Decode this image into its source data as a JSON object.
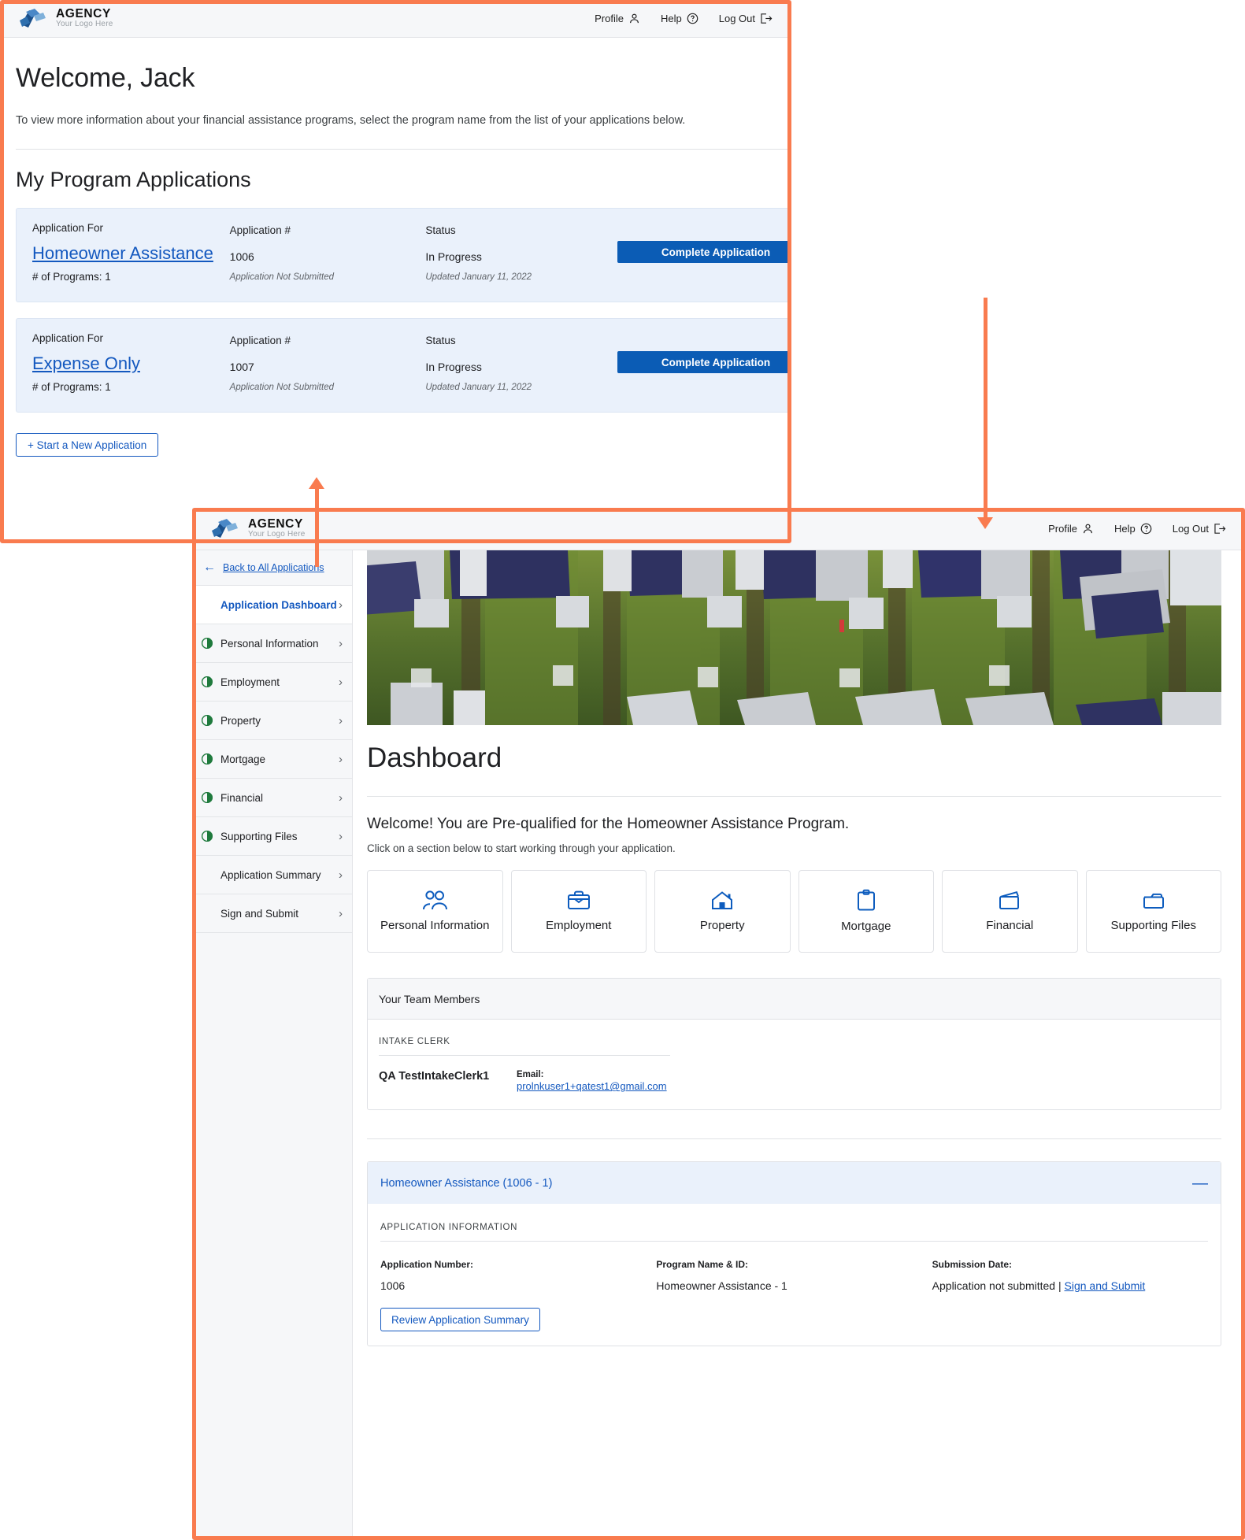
{
  "brand": {
    "name": "AGENCY",
    "tagline": "Your Logo Here"
  },
  "topnav": {
    "profile": "Profile",
    "help": "Help",
    "logout": "Log Out"
  },
  "outer": {
    "heading": "Welcome, Jack",
    "intro": "To view more information about your financial assistance programs, select the program name from the list of your applications below.",
    "section_title": "My Program Applications",
    "columns": {
      "application_for": "Application For",
      "application_number": "Application #",
      "status": "Status"
    },
    "applications": [
      {
        "program": "Homeowner Assistance",
        "programs_count": "# of Programs: 1",
        "number": "1006",
        "number_note": "Application Not Submitted",
        "status": "In Progress",
        "status_note": "Updated January 11, 2022",
        "action": "Complete Application"
      },
      {
        "program": "Expense Only",
        "programs_count": "# of Programs: 1",
        "number": "1007",
        "number_note": "Application Not Submitted",
        "status": "In Progress",
        "status_note": "Updated January 11, 2022",
        "action": "Complete Application"
      }
    ],
    "start_new": "+ Start a New Application"
  },
  "inner": {
    "sidebar": {
      "back": "Back to All Applications",
      "items": [
        {
          "label": "Application Dashboard",
          "state": "active",
          "progress": false
        },
        {
          "label": "Personal Information",
          "state": "normal",
          "progress": true
        },
        {
          "label": "Employment",
          "state": "normal",
          "progress": true
        },
        {
          "label": "Property",
          "state": "normal",
          "progress": true
        },
        {
          "label": "Mortgage",
          "state": "normal",
          "progress": true
        },
        {
          "label": "Financial",
          "state": "normal",
          "progress": true
        },
        {
          "label": "Supporting Files",
          "state": "normal",
          "progress": true
        },
        {
          "label": "Application Summary",
          "state": "normal",
          "progress": false
        },
        {
          "label": "Sign and Submit",
          "state": "normal",
          "progress": false
        }
      ]
    },
    "main": {
      "title": "Dashboard",
      "welcome": "Welcome! You are Pre-qualified for the Homeowner Assistance Program.",
      "subtitle": "Click on a section below to start working through your application.",
      "tiles": [
        {
          "label": "Personal Information",
          "icon": "people-icon"
        },
        {
          "label": "Employment",
          "icon": "briefcase-icon"
        },
        {
          "label": "Property",
          "icon": "house-icon"
        },
        {
          "label": "Mortgage",
          "icon": "clipboard-icon"
        },
        {
          "label": "Financial",
          "icon": "wallet-icon"
        },
        {
          "label": "Supporting Files",
          "icon": "folder-icon"
        }
      ],
      "team": {
        "panel_title": "Your Team Members",
        "role": "INTAKE CLERK",
        "member_name": "QA TestIntakeClerk1",
        "email_label": "Email:",
        "email": "prolnkuser1+qatest1@gmail.com"
      },
      "accordion": {
        "title": "Homeowner Assistance (1006 - 1)",
        "toggle": "—",
        "section_caption": "APPLICATION INFORMATION",
        "fields": [
          {
            "label": "Application Number:",
            "value": "1006"
          },
          {
            "label": "Program Name & ID:",
            "value": "Homeowner Assistance - 1"
          }
        ],
        "submission_label": "Submission Date:",
        "submission_value": "Application not submitted |",
        "submission_link": "Sign and Submit",
        "review_button": "Review Application Summary"
      }
    }
  },
  "colors": {
    "accent_orange": "#f97b4f",
    "brand_blue": "#1358bf",
    "button_blue": "#0b5cb5",
    "card_blue": "#eaf1fb",
    "progress_green": "#1f7a3d"
  }
}
